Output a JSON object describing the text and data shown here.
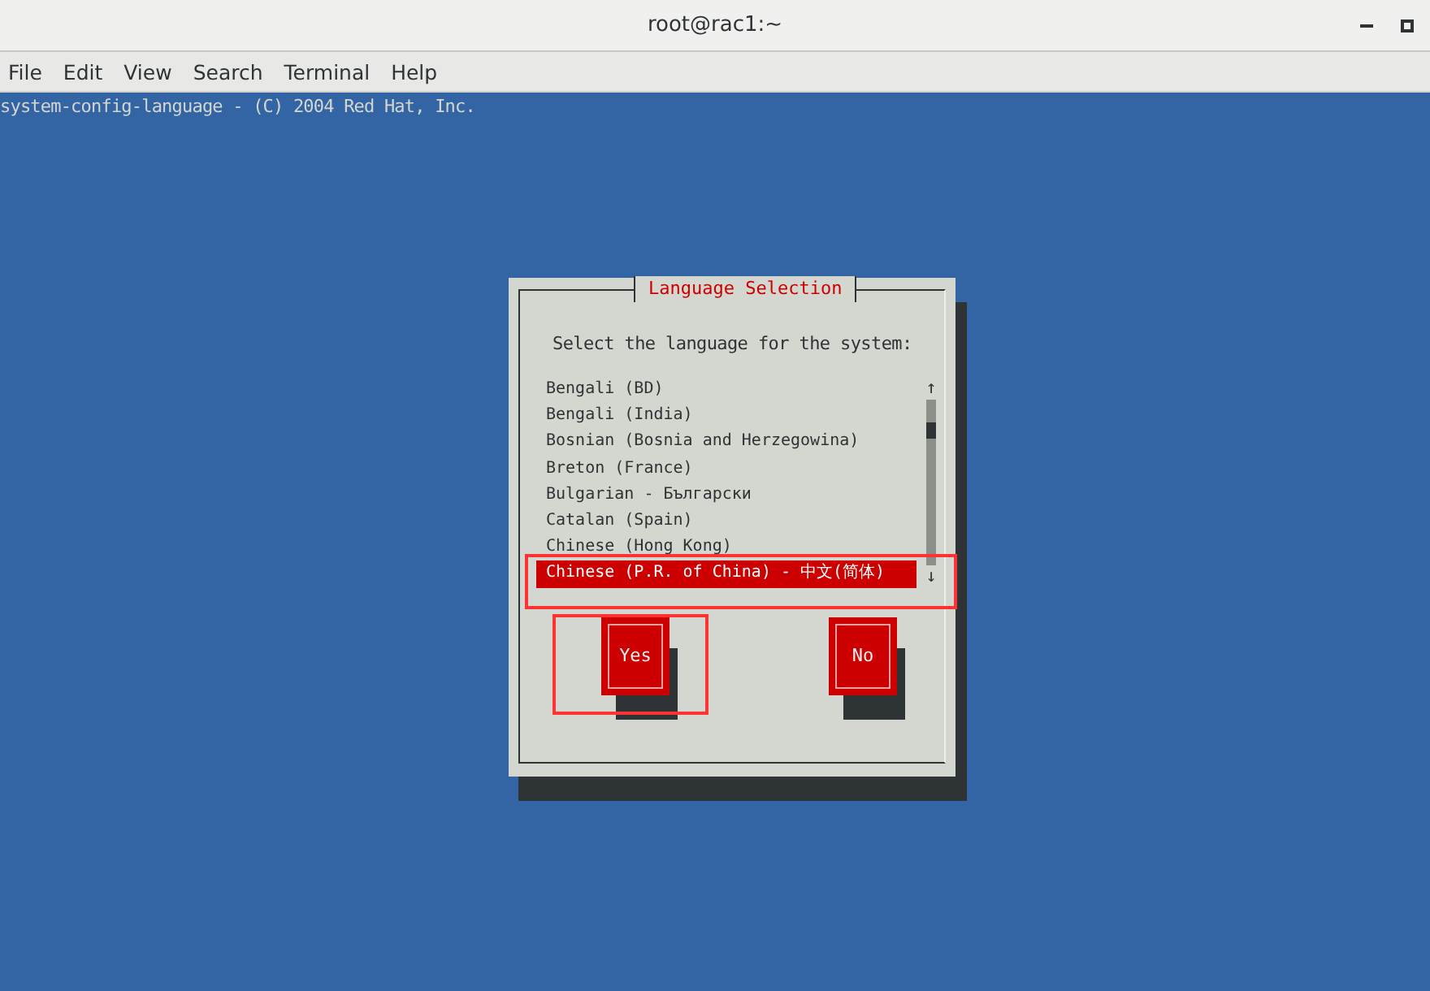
{
  "window": {
    "title": "root@rac1:~"
  },
  "menu": [
    "File",
    "Edit",
    "View",
    "Search",
    "Terminal",
    "Help"
  ],
  "terminal": {
    "header": "system-config-language - (C) 2004 Red Hat, Inc."
  },
  "dialog": {
    "title": "Language Selection",
    "prompt": "Select the language for the system:",
    "items": [
      {
        "label": "Bengali (BD)",
        "selected": false
      },
      {
        "label": "Bengali (India)",
        "selected": false
      },
      {
        "label": "Bosnian (Bosnia and Herzegowina)",
        "selected": false
      },
      {
        "label": "Breton (France)",
        "selected": false
      },
      {
        "label": "Bulgarian - Български",
        "selected": false
      },
      {
        "label": "Catalan (Spain)",
        "selected": false
      },
      {
        "label": "Chinese (Hong Kong)",
        "selected": false
      },
      {
        "label": "Chinese (P.R. of China) - 中文(简体)",
        "selected": true
      }
    ],
    "scroll_up": "↑",
    "scroll_down": "↓",
    "buttons": [
      {
        "label": "Yes"
      },
      {
        "label": "No"
      }
    ]
  }
}
